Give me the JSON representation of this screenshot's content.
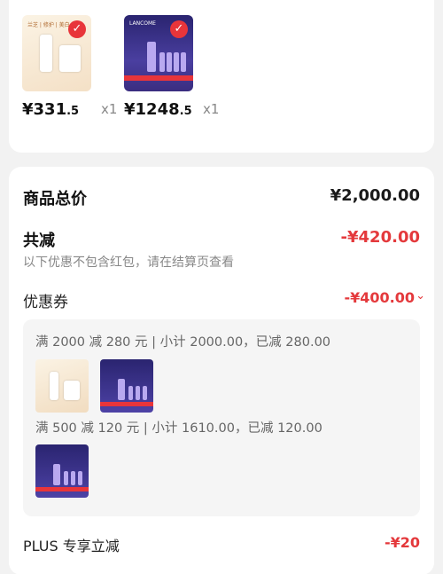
{
  "items": [
    {
      "currency": "¥",
      "price_int": "331",
      "price_dec": ".5",
      "qty": "x1",
      "brand_text": "兰芝 | 修护 | 美白"
    },
    {
      "currency": "¥",
      "price_int": "1248",
      "price_dec": ".5",
      "qty": "x1",
      "brand_text": "LANCOME"
    }
  ],
  "summary": {
    "total_label": "商品总价",
    "total_value": "¥2,000.00",
    "reduce_label": "共减",
    "reduce_value": "-¥420.00",
    "reduce_note": "以下优惠不包含红包，请在结算页查看",
    "coupon_label": "优惠券",
    "coupon_value": "-¥400.00"
  },
  "coupon_details": [
    {
      "text": "满 2000 减 280 元 | 小计 2000.00，已减 280.00"
    },
    {
      "text": "满 500 减 120 元 | 小计 1610.00，已减 120.00"
    }
  ],
  "plus": {
    "label": "PLUS 专享立减",
    "value": "-¥20"
  },
  "colors": {
    "accent_red": "#e4393c",
    "background": "#f2f2f2"
  },
  "icons": {
    "check": "checkmark-icon",
    "chevron": "chevron-down-icon"
  }
}
